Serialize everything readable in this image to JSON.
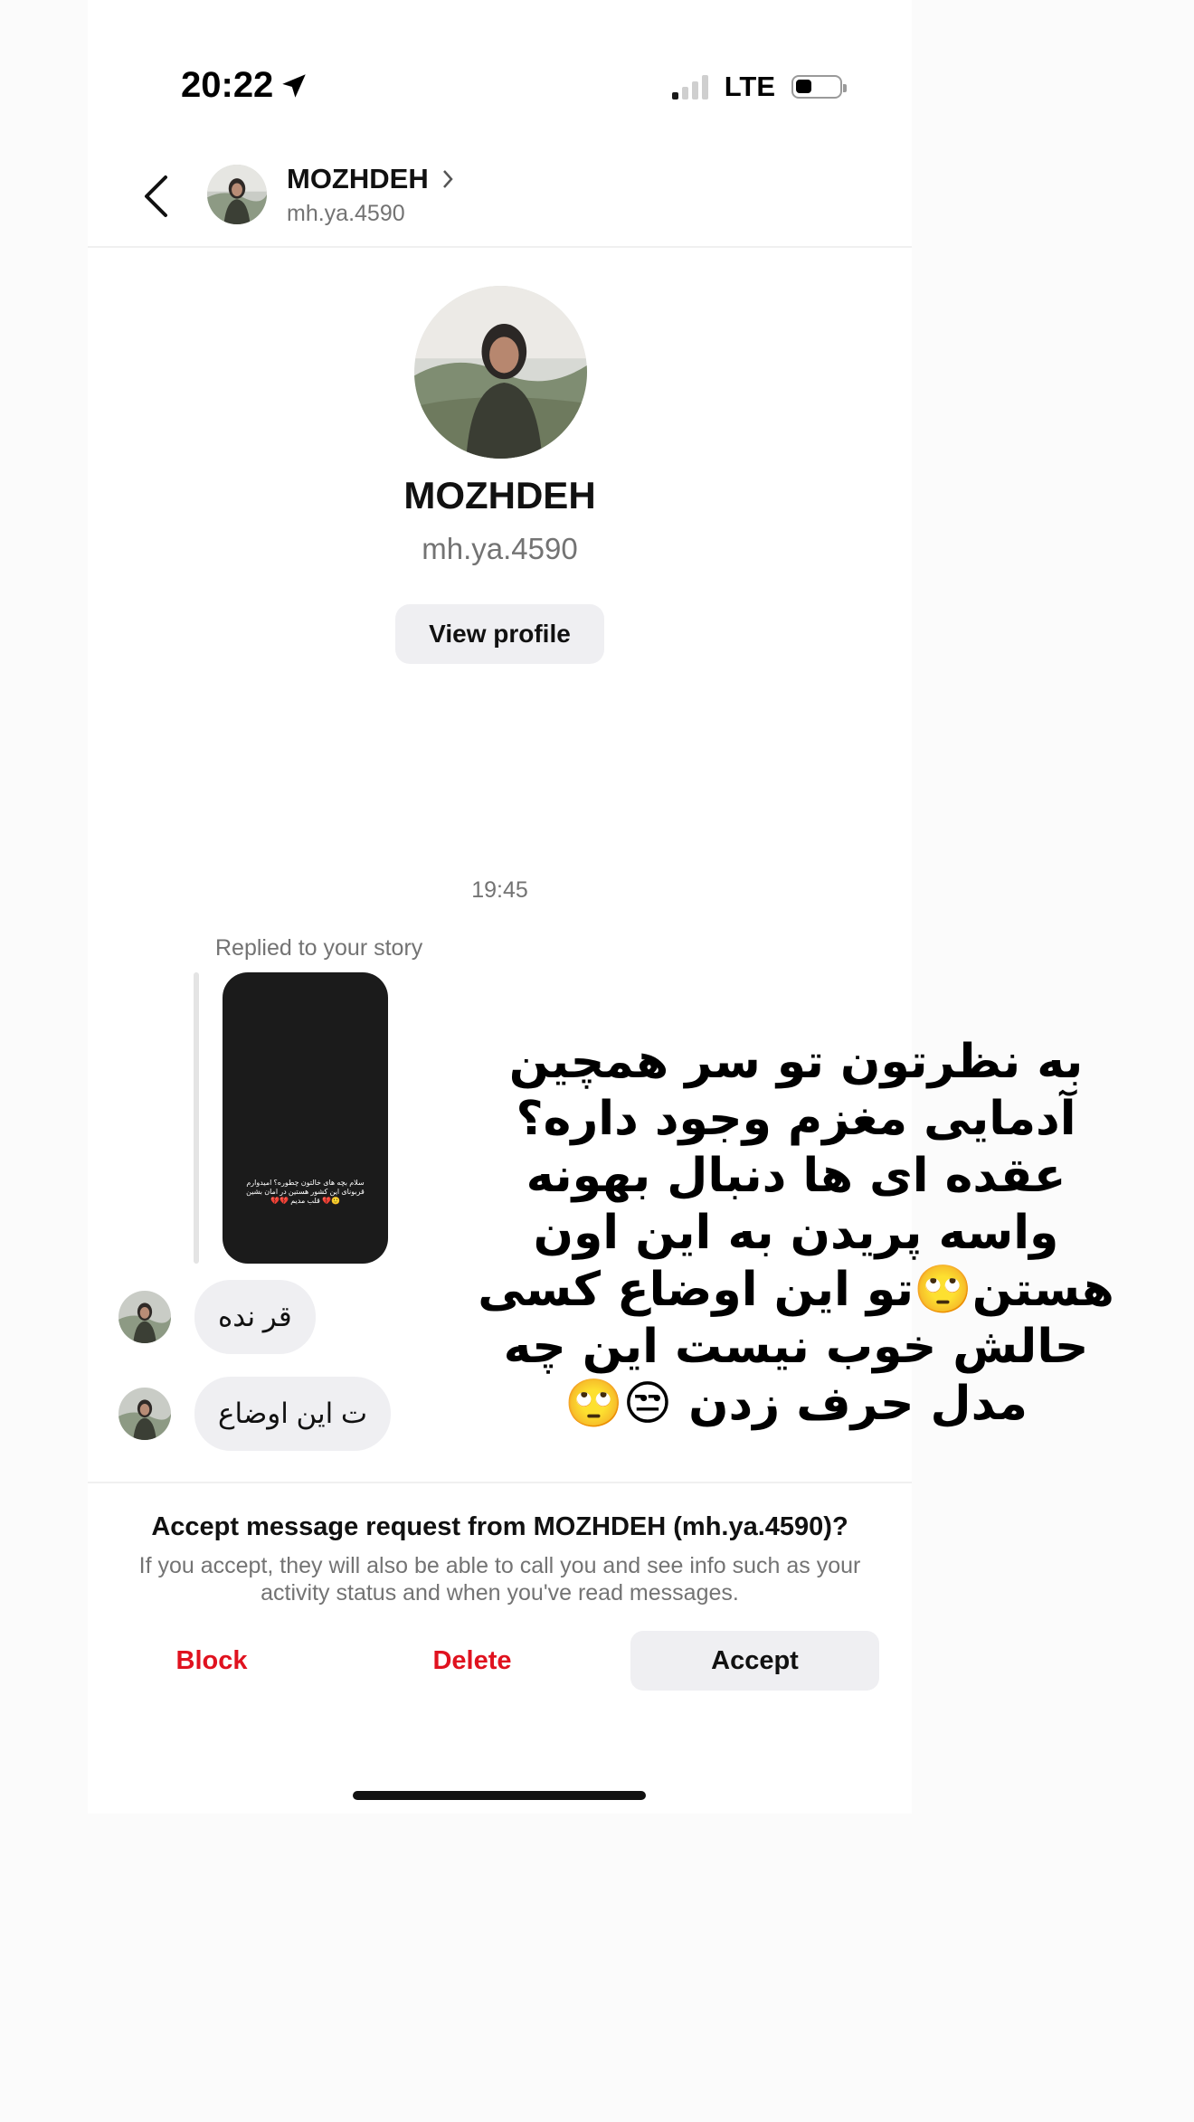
{
  "status_bar": {
    "time": "20:22",
    "network": "LTE"
  },
  "header": {
    "name": "MOZHDEH",
    "username": "mh.ya.4590"
  },
  "profile": {
    "name": "MOZHDEH",
    "username": "mh.ya.4590",
    "view_profile_label": "View profile"
  },
  "thread": {
    "timestamp": "19:45",
    "replied_label": "Replied to your story",
    "story_text": "سلام بچه های خالتون چطوره؟ امیدوارم قربونای این کشور هستین در امان بشین 🙂💔 قلب مدیم 💔💔",
    "messages": [
      "قر نده",
      "ت این اوضاع"
    ]
  },
  "request": {
    "title": "Accept message request from MOZHDEH (mh.ya.4590)?",
    "body": "If you accept, they will also be able to call you and see info such as your activity status and when you've read messages.",
    "block_label": "Block",
    "delete_label": "Delete",
    "accept_label": "Accept"
  },
  "overlay_text": "به نظرتون تو سر همچین آدمایی مغزم وجود داره؟عقده ای ها دنبال بهونه واسه پریدن به این اون هستن🙄تو این اوضاع کسی حالش خوب نیست این چه مدل حرف زدن 😒🙄",
  "colors": {
    "destructive": "#e0121f",
    "bubble": "#efeff2",
    "secondary_text": "#737373"
  }
}
